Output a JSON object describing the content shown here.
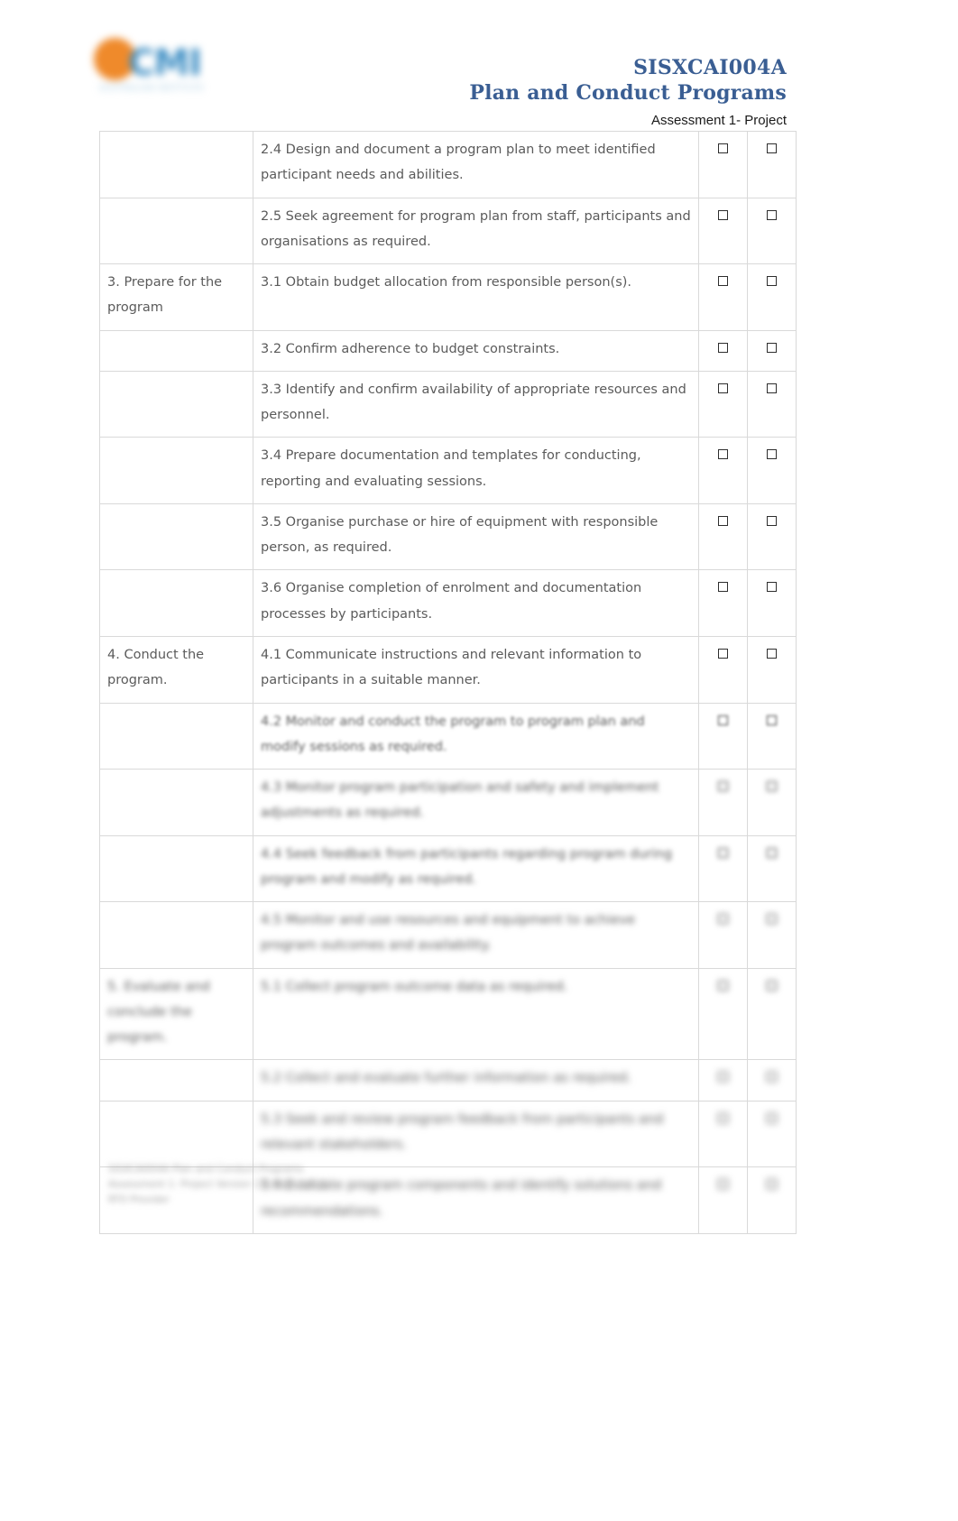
{
  "header": {
    "logo": {
      "name": "institute-logo",
      "word": "CMI",
      "sub": "AUSTRALIAN INSTITUTE",
      "dot_color": "#ef8a2b",
      "word_color": "#3f8fc4"
    },
    "unit_code": "SISXCAI004A",
    "unit_title": "Plan and Conduct Programs",
    "assessment": "Assessment 1- Project",
    "title_color": "#3a5e93"
  },
  "table": {
    "rows": [
      {
        "section": "",
        "criteria": "2.4 Design and document a program plan to meet identified participant needs and abilities.",
        "blur": "b0"
      },
      {
        "section": "",
        "criteria": "2.5 Seek agreement for program plan from staff, participants and organisations as required.",
        "blur": "b0"
      },
      {
        "section": "3. Prepare for the program",
        "criteria": "3.1 Obtain budget allocation from responsible person(s).",
        "blur": "b0"
      },
      {
        "section": "",
        "criteria": "3.2 Confirm adherence to budget constraints.",
        "blur": "b0"
      },
      {
        "section": "",
        "criteria": "3.3 Identify and confirm availability of appropriate resources and personnel.",
        "blur": "b0"
      },
      {
        "section": "",
        "criteria": "3.4 Prepare documentation and templates for conducting, reporting and evaluating sessions.",
        "blur": "b0"
      },
      {
        "section": "",
        "criteria": "3.5 Organise purchase or hire of equipment with responsible person, as required.",
        "blur": "b0"
      },
      {
        "section": "",
        "criteria": "3.6 Organise completion of enrolment and documentation processes by participants.",
        "blur": "b0"
      },
      {
        "section": "4. Conduct the program.",
        "criteria": "4.1 Communicate instructions and relevant information to participants in a suitable manner.",
        "blur": "b0"
      },
      {
        "section": "",
        "criteria": "4.2 Monitor and conduct the program to program plan and modify sessions as required.",
        "blur": "b2"
      },
      {
        "section": "",
        "criteria": "4.3 Monitor program participation and safety and implement adjustments as required.",
        "blur": "b3"
      },
      {
        "section": "",
        "criteria": "4.4 Seek feedback from participants regarding program during program and modify as required.",
        "blur": "b3"
      },
      {
        "section": "",
        "criteria": "4.5 Monitor and use resources and equipment to achieve program outcomes and availability.",
        "blur": "b4"
      },
      {
        "section": "5. Evaluate and conclude the program.",
        "criteria": "5.1 Collect program outcome data as required.",
        "blur": "b4"
      },
      {
        "section": "",
        "criteria": "5.2 Collect and evaluate further information as required.",
        "blur": "b5"
      },
      {
        "section": "",
        "criteria": "5.3 Seek and review program feedback from participants and relevant stakeholders.",
        "blur": "b5"
      },
      {
        "section": "",
        "criteria": "5.4 Evaluate program components and identify solutions and recommendations.",
        "blur": "b5"
      }
    ],
    "checkbox_columns": 2,
    "checkbox_glyph": "empty-square"
  },
  "footer": {
    "line1": "SISXCAI004A Plan and Conduct Programs",
    "line2": "Assessment 1- Project   Version 1.0   Page 3 of 8",
    "line3": "RTO Provider"
  }
}
